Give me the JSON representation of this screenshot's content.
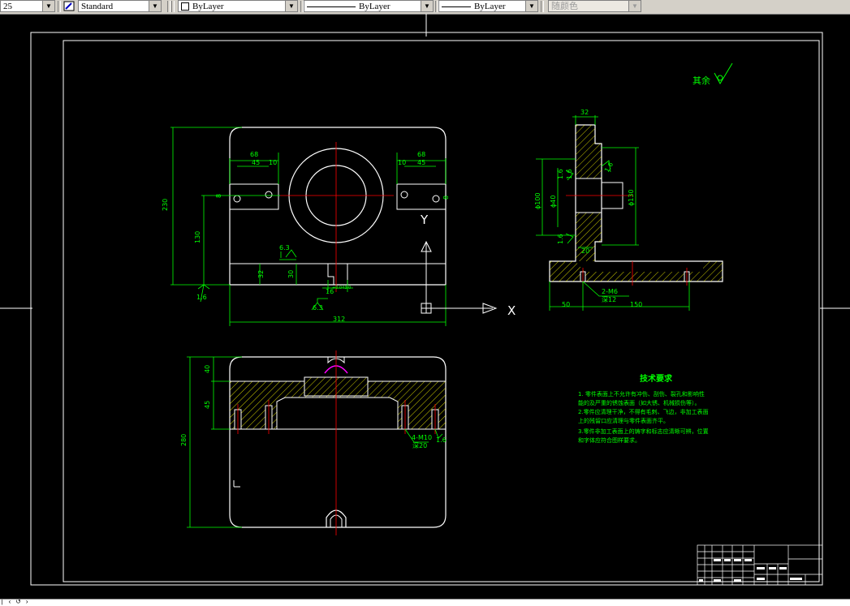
{
  "toolbar": {
    "dimscale_value": "25",
    "textstyle_value": "Standard",
    "layer_value": "ByLayer",
    "linetype_value": "ByLayer",
    "lineweight_value": "ByLayer",
    "color_value": "随颜色"
  },
  "drawing": {
    "roughness_note": "其余",
    "front_view": {
      "dim_68_left": "68",
      "dim_45_left": "45",
      "dim_10_left": "10",
      "dim_68_right": "68",
      "dim_10_right": "10",
      "dim_45_right": "45",
      "dim_230": "230",
      "dim_130": "130",
      "dim_312": "312",
      "dim_32": "32",
      "dim_30": "30",
      "dim_16": "16",
      "tol_16": "+0.043\n0",
      "rough_63_top": "6.3",
      "rough_63_bottom": "6.3",
      "rough_16": "1.6",
      "dim_hole_left": "8",
      "dim_hole_right": "8"
    },
    "axis": {
      "y_label": "Y",
      "x_label": "X"
    },
    "side_view": {
      "dim_32": "32",
      "dim_phi100": "ϕ100",
      "dim_phi40": "ϕ40",
      "dim_phi130": "ϕ130",
      "rough_16_a": "1.6",
      "rough_16_b": "1.6",
      "rough_16_c": "1.6",
      "rough_16_d": "1.6",
      "dim_20": "20",
      "dim_50": "50",
      "dim_150": "150",
      "hole_note": "2-M6",
      "hole_depth": "深12"
    },
    "top_view": {
      "dim_40": "40",
      "dim_45": "45",
      "dim_280": "280",
      "hole_note": "4-M10",
      "hole_depth": "深20",
      "rough_16": "1.6"
    },
    "tech_req": {
      "title": "技术要求",
      "lines": [
        "1. 零件表面上不允许有冲伤、刮伤、裂孔和影响性",
        "能的及严重的锈蚀表面（如大锈、机械损伤等）。",
        "2.零件应清理干净，不得有毛刺、飞边，非加工表面",
        "上的残留口应清理与零件表面齐平。",
        "3.零件非加工表面上的铸字和标志应清晰可辨，位置",
        "和字体应符合图样要求。"
      ]
    }
  },
  "colors": {
    "background": "#000000",
    "outline": "#ffffff",
    "dimension": "#00ff00",
    "centerline": "#ff0000",
    "hatch": "#ffff00",
    "hole": "#ff00ff"
  },
  "cmdline": {
    "text": "|  ‹ ↺ ›"
  }
}
